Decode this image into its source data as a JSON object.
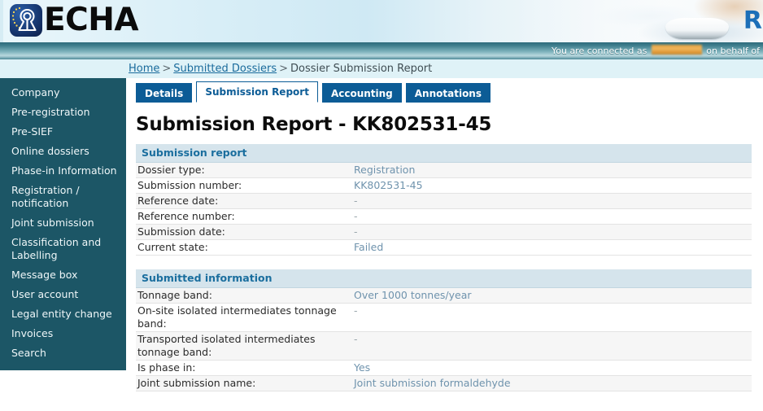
{
  "banner": {
    "logo_text": "ECHA",
    "logo_icon": "echa-logo-icon",
    "reach_text": "R"
  },
  "connected_bar": {
    "prefix": "You are connected as",
    "username_redacted": "",
    "suffix": "on behalf of"
  },
  "breadcrumb": {
    "items": [
      {
        "label": "Home",
        "link": true
      },
      {
        "label": "Submitted Dossiers",
        "link": true
      },
      {
        "label": "Dossier Submission Report",
        "link": false
      }
    ],
    "separator": ">"
  },
  "sidebar": {
    "items": [
      {
        "label": "Company"
      },
      {
        "label": "Pre-registration"
      },
      {
        "label": "Pre-SIEF"
      },
      {
        "label": "Online dossiers"
      },
      {
        "label": "Phase-in Information"
      },
      {
        "label": "Registration / notification"
      },
      {
        "label": "Joint submission"
      },
      {
        "label": "Classification and Labelling"
      },
      {
        "label": "Message box"
      },
      {
        "label": "User account"
      },
      {
        "label": "Legal entity change"
      },
      {
        "label": "Invoices"
      },
      {
        "label": "Search"
      }
    ]
  },
  "tabs": [
    {
      "label": "Details",
      "active": false
    },
    {
      "label": "Submission Report",
      "active": true
    },
    {
      "label": "Accounting",
      "active": false
    },
    {
      "label": "Annotations",
      "active": false
    }
  ],
  "main": {
    "page_title": "Submission Report - KK802531-45",
    "sections": [
      {
        "header": "Submission report",
        "rows": [
          {
            "label": "Dossier type:",
            "value": "Registration"
          },
          {
            "label": "Submission number:",
            "value": "KK802531-45"
          },
          {
            "label": "Reference date:",
            "value": "-"
          },
          {
            "label": "Reference number:",
            "value": "-"
          },
          {
            "label": "Submission date:",
            "value": "-"
          },
          {
            "label": "Current state:",
            "value": "Failed"
          }
        ]
      },
      {
        "header": "Submitted information",
        "rows": [
          {
            "label": "Tonnage band:",
            "value": "Over 1000 tonnes/year"
          },
          {
            "label": "On-site isolated intermediates tonnage band:",
            "value": "-"
          },
          {
            "label": "Transported isolated intermediates tonnage band:",
            "value": "-"
          },
          {
            "label": "Is phase in:",
            "value": "Yes"
          },
          {
            "label": "Joint submission name:",
            "value": "Joint submission formaldehyde"
          }
        ]
      }
    ]
  },
  "colors": {
    "sidebar_bg": "#1c5666",
    "tab_blue": "#0c5c96",
    "section_header_bg": "#d5e4ec",
    "section_header_text": "#1a6e9e",
    "value_text": "#6f93ad",
    "link": "#1a6b9c"
  }
}
